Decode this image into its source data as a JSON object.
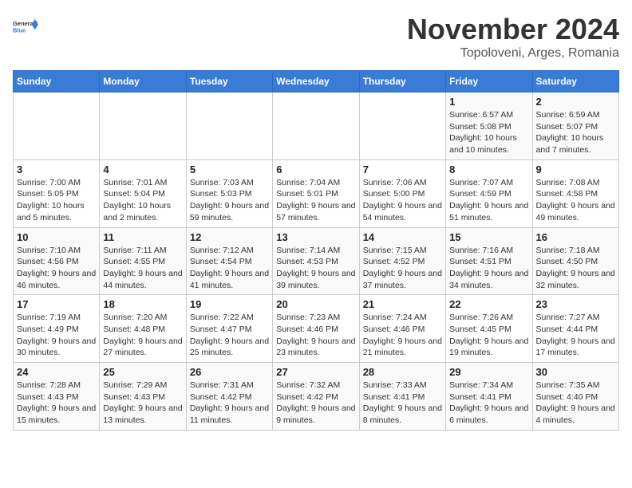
{
  "header": {
    "logo_general": "General",
    "logo_blue": "Blue",
    "month": "November 2024",
    "location": "Topoloveni, Arges, Romania"
  },
  "days_of_week": [
    "Sunday",
    "Monday",
    "Tuesday",
    "Wednesday",
    "Thursday",
    "Friday",
    "Saturday"
  ],
  "weeks": [
    [
      {
        "day": "",
        "info": ""
      },
      {
        "day": "",
        "info": ""
      },
      {
        "day": "",
        "info": ""
      },
      {
        "day": "",
        "info": ""
      },
      {
        "day": "",
        "info": ""
      },
      {
        "day": "1",
        "info": "Sunrise: 6:57 AM\nSunset: 5:08 PM\nDaylight: 10 hours and 10 minutes."
      },
      {
        "day": "2",
        "info": "Sunrise: 6:59 AM\nSunset: 5:07 PM\nDaylight: 10 hours and 7 minutes."
      }
    ],
    [
      {
        "day": "3",
        "info": "Sunrise: 7:00 AM\nSunset: 5:05 PM\nDaylight: 10 hours and 5 minutes."
      },
      {
        "day": "4",
        "info": "Sunrise: 7:01 AM\nSunset: 5:04 PM\nDaylight: 10 hours and 2 minutes."
      },
      {
        "day": "5",
        "info": "Sunrise: 7:03 AM\nSunset: 5:03 PM\nDaylight: 9 hours and 59 minutes."
      },
      {
        "day": "6",
        "info": "Sunrise: 7:04 AM\nSunset: 5:01 PM\nDaylight: 9 hours and 57 minutes."
      },
      {
        "day": "7",
        "info": "Sunrise: 7:06 AM\nSunset: 5:00 PM\nDaylight: 9 hours and 54 minutes."
      },
      {
        "day": "8",
        "info": "Sunrise: 7:07 AM\nSunset: 4:59 PM\nDaylight: 9 hours and 51 minutes."
      },
      {
        "day": "9",
        "info": "Sunrise: 7:08 AM\nSunset: 4:58 PM\nDaylight: 9 hours and 49 minutes."
      }
    ],
    [
      {
        "day": "10",
        "info": "Sunrise: 7:10 AM\nSunset: 4:56 PM\nDaylight: 9 hours and 46 minutes."
      },
      {
        "day": "11",
        "info": "Sunrise: 7:11 AM\nSunset: 4:55 PM\nDaylight: 9 hours and 44 minutes."
      },
      {
        "day": "12",
        "info": "Sunrise: 7:12 AM\nSunset: 4:54 PM\nDaylight: 9 hours and 41 minutes."
      },
      {
        "day": "13",
        "info": "Sunrise: 7:14 AM\nSunset: 4:53 PM\nDaylight: 9 hours and 39 minutes."
      },
      {
        "day": "14",
        "info": "Sunrise: 7:15 AM\nSunset: 4:52 PM\nDaylight: 9 hours and 37 minutes."
      },
      {
        "day": "15",
        "info": "Sunrise: 7:16 AM\nSunset: 4:51 PM\nDaylight: 9 hours and 34 minutes."
      },
      {
        "day": "16",
        "info": "Sunrise: 7:18 AM\nSunset: 4:50 PM\nDaylight: 9 hours and 32 minutes."
      }
    ],
    [
      {
        "day": "17",
        "info": "Sunrise: 7:19 AM\nSunset: 4:49 PM\nDaylight: 9 hours and 30 minutes."
      },
      {
        "day": "18",
        "info": "Sunrise: 7:20 AM\nSunset: 4:48 PM\nDaylight: 9 hours and 27 minutes."
      },
      {
        "day": "19",
        "info": "Sunrise: 7:22 AM\nSunset: 4:47 PM\nDaylight: 9 hours and 25 minutes."
      },
      {
        "day": "20",
        "info": "Sunrise: 7:23 AM\nSunset: 4:46 PM\nDaylight: 9 hours and 23 minutes."
      },
      {
        "day": "21",
        "info": "Sunrise: 7:24 AM\nSunset: 4:46 PM\nDaylight: 9 hours and 21 minutes."
      },
      {
        "day": "22",
        "info": "Sunrise: 7:26 AM\nSunset: 4:45 PM\nDaylight: 9 hours and 19 minutes."
      },
      {
        "day": "23",
        "info": "Sunrise: 7:27 AM\nSunset: 4:44 PM\nDaylight: 9 hours and 17 minutes."
      }
    ],
    [
      {
        "day": "24",
        "info": "Sunrise: 7:28 AM\nSunset: 4:43 PM\nDaylight: 9 hours and 15 minutes."
      },
      {
        "day": "25",
        "info": "Sunrise: 7:29 AM\nSunset: 4:43 PM\nDaylight: 9 hours and 13 minutes."
      },
      {
        "day": "26",
        "info": "Sunrise: 7:31 AM\nSunset: 4:42 PM\nDaylight: 9 hours and 11 minutes."
      },
      {
        "day": "27",
        "info": "Sunrise: 7:32 AM\nSunset: 4:42 PM\nDaylight: 9 hours and 9 minutes."
      },
      {
        "day": "28",
        "info": "Sunrise: 7:33 AM\nSunset: 4:41 PM\nDaylight: 9 hours and 8 minutes."
      },
      {
        "day": "29",
        "info": "Sunrise: 7:34 AM\nSunset: 4:41 PM\nDaylight: 9 hours and 6 minutes."
      },
      {
        "day": "30",
        "info": "Sunrise: 7:35 AM\nSunset: 4:40 PM\nDaylight: 9 hours and 4 minutes."
      }
    ]
  ]
}
